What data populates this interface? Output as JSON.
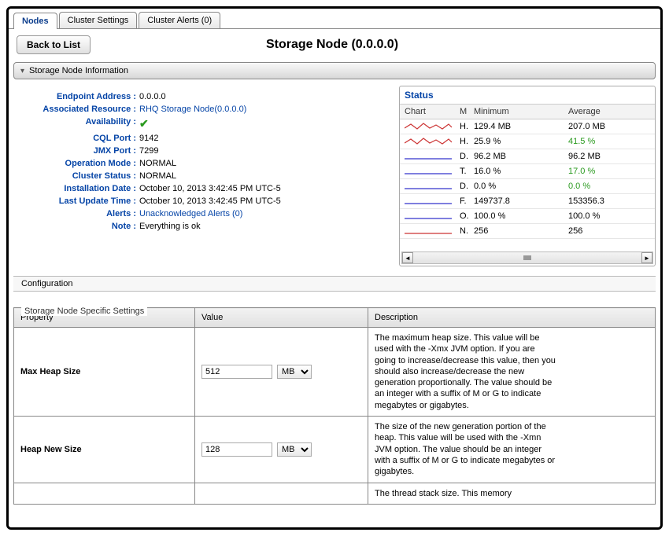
{
  "tabs": {
    "nodes": "Nodes",
    "cluster_settings": "Cluster Settings",
    "cluster_alerts": "Cluster Alerts (0)"
  },
  "back_label": "Back to List",
  "page_title": "Storage Node (0.0.0.0)",
  "section": {
    "info_header": "Storage Node Information"
  },
  "info": {
    "endpoint_k": "Endpoint Address :",
    "endpoint_v": "0.0.0.0",
    "resource_k": "Associated Resource :",
    "resource_v": "RHQ Storage Node(0.0.0.0)",
    "avail_k": "Availability :",
    "cql_k": "CQL Port :",
    "cql_v": "9142",
    "jmx_k": "JMX Port :",
    "jmx_v": "7299",
    "opmode_k": "Operation Mode :",
    "opmode_v": "NORMAL",
    "clstat_k": "Cluster Status :",
    "clstat_v": "NORMAL",
    "install_k": "Installation Date :",
    "install_v": "October 10, 2013 3:42:45 PM UTC-5",
    "update_k": "Last Update Time :",
    "update_v": "October 10, 2013 3:42:45 PM UTC-5",
    "alerts_k": "Alerts :",
    "alerts_v": "Unacknowledged Alerts (0)",
    "note_k": "Note :",
    "note_v": "Everything is ok"
  },
  "status": {
    "title": "Status",
    "head_chart": "Chart",
    "head_m": "M",
    "head_min": "Minimum",
    "head_avg": "Average",
    "rows": [
      {
        "label": "H.",
        "min": "129.4 MB",
        "avg": "207.0 MB",
        "green": false,
        "color": "#c33"
      },
      {
        "label": "H.",
        "min": "25.9 %",
        "avg": "41.5 %",
        "green": true,
        "color": "#c33"
      },
      {
        "label": "D.",
        "min": "96.2 MB",
        "avg": "96.2 MB",
        "green": false,
        "color": "#33c"
      },
      {
        "label": "T.",
        "min": "16.0 %",
        "avg": "17.0 %",
        "green": true,
        "color": "#33c"
      },
      {
        "label": "D.",
        "min": "0.0 %",
        "avg": "0.0 %",
        "green": true,
        "color": "#33c"
      },
      {
        "label": "F.",
        "min": "149737.8",
        "avg": "153356.3",
        "green": false,
        "color": "#33c"
      },
      {
        "label": "O.",
        "min": "100.0 %",
        "avg": "100.0 %",
        "green": false,
        "color": "#33c"
      },
      {
        "label": "N.",
        "min": "256",
        "avg": "256",
        "green": false,
        "color": "#c33"
      }
    ]
  },
  "config": {
    "header": "Configuration",
    "legend": "Storage Node Specific Settings",
    "col_prop": "Property",
    "col_val": "Value",
    "col_desc": "Description",
    "rows": [
      {
        "prop": "Max Heap Size",
        "value": "512",
        "unit": "MB",
        "desc": "The maximum heap size. This value will be used with the -Xmx JVM option. If you are going to increase/decrease this value, then you should also increase/decrease the new generation proportionally. The value should be an integer with a suffix of M or G to indicate megabytes or gigabytes."
      },
      {
        "prop": "Heap New Size",
        "value": "128",
        "unit": "MB",
        "desc": "The size of the new generation portion of the heap. This value will be used with the -Xmn JVM option. The value should be an integer with a suffix of M or G to indicate megabytes or gigabytes."
      },
      {
        "prop": "",
        "value": "",
        "unit": "",
        "desc": "The thread stack size. This memory"
      }
    ]
  }
}
